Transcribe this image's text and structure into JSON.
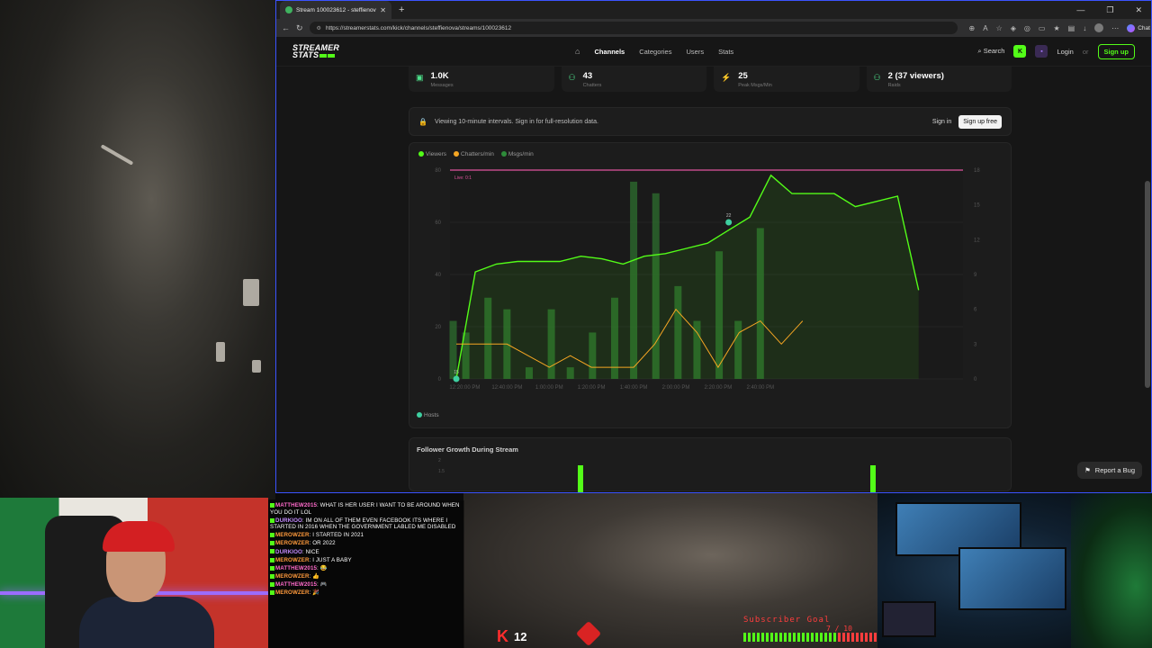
{
  "browser": {
    "tab_title": "Stream 100023612 - steffienova -",
    "url": "https://streamerstats.com/kick/channels/steffienova/streams/100023612",
    "chat_label": "Chat"
  },
  "site": {
    "logo_top": "STREAMER",
    "logo_bottom": "STATS",
    "nav": [
      "Channels",
      "Categories",
      "Users",
      "Stats"
    ],
    "search": "Search",
    "login": "Login",
    "or": "or",
    "signup": "Sign up"
  },
  "stats": [
    {
      "icon": "message-icon",
      "value": "1.0K",
      "label": "Messages"
    },
    {
      "icon": "users-icon",
      "value": "43",
      "label": "Chatters"
    },
    {
      "icon": "bolt-icon",
      "value": "25",
      "label": "Peak Msgs/Min"
    },
    {
      "icon": "users-icon",
      "value": "2 (37 viewers)",
      "label": "Raids"
    }
  ],
  "notice": {
    "text": "Viewing 10-minute intervals. Sign in for full-resolution data.",
    "signin": "Sign in",
    "signup": "Sign up free"
  },
  "chart_data": {
    "type": "line",
    "legend": [
      {
        "name": "Viewers",
        "color": "#53fc18"
      },
      {
        "name": "Chatters/min",
        "color": "#f5a623"
      },
      {
        "name": "Msgs/min",
        "color": "#2e8b3a"
      }
    ],
    "x_ticks": [
      "12:20:00 PM",
      "12:40:00 PM",
      "1:00:00 PM",
      "1:20:00 PM",
      "1:40:00 PM",
      "2:00:00 PM",
      "2:20:00 PM",
      "2:40:00 PM"
    ],
    "y_left_ticks": [
      "0",
      "20",
      "40",
      "60",
      "80"
    ],
    "y_right_ticks": [
      "0",
      "3",
      "6",
      "9",
      "12",
      "15",
      "18"
    ],
    "live_label": "Live: 0:1",
    "viewers_x": [
      12.2,
      12.5,
      12.833,
      13.167,
      13.5,
      13.833,
      14.167,
      14.5,
      14.833,
      15.167,
      15.5,
      15.833,
      16.167,
      16.5,
      16.833,
      17.167,
      17.5,
      17.833,
      18.167,
      18.5,
      18.833,
      19.167,
      19.5,
      19.833,
      20.167
    ],
    "viewers": [
      0,
      41,
      44,
      45,
      45,
      45,
      47,
      46,
      44,
      47,
      48,
      50,
      52,
      57,
      62,
      78,
      71,
      71,
      71,
      66,
      68,
      70,
      34,
      0,
      0
    ],
    "chatters_x": [
      12.2,
      12.333,
      12.667,
      13.0,
      13.333,
      13.667,
      14.0,
      14.333,
      14.667,
      15.0,
      15.333,
      15.667,
      16.0,
      16.333,
      16.667,
      17.0,
      17.333,
      17.667,
      18.0,
      18.333
    ],
    "chatters": [
      3,
      3,
      3,
      3,
      2,
      1,
      2,
      1,
      1,
      1,
      3,
      6,
      4,
      1,
      4,
      5,
      3,
      5,
      0,
      0
    ],
    "bars_x": [
      12.15,
      12.35,
      12.7,
      13.0,
      13.35,
      13.7,
      14.0,
      14.35,
      14.7,
      15.0,
      15.35,
      15.7,
      16.0,
      16.35,
      16.65,
      17.0,
      17.35,
      17.65,
      18.0,
      18.35
    ],
    "msgs": [
      5,
      4,
      7,
      6,
      1,
      6,
      1,
      4,
      7,
      17,
      16,
      8,
      5,
      11,
      5,
      13,
      0,
      0,
      0,
      0
    ],
    "markers": [
      {
        "label": "15",
        "x": 12.2,
        "y": 0
      },
      {
        "label": "22",
        "x": 16.5,
        "y": 60
      }
    ],
    "xlim": [
      12.1,
      20.2
    ],
    "ylim": [
      0,
      80
    ],
    "y2lim": [
      0,
      18
    ]
  },
  "hosts_label": "Hosts",
  "follower": {
    "title": "Follower Growth During Stream",
    "y_ticks": [
      "2",
      "1.5"
    ]
  },
  "report_bug": "Report a Bug",
  "overlay": {
    "chat": [
      {
        "user": "MATTHEW2015",
        "msg": "WHAT IS HER USER I WANT TO BE AROUND WHEN YOU DO IT LOL",
        "color": "#ff6bcb"
      },
      {
        "user": "DURKIOO",
        "msg": "IM ON ALL OF THEM EVEN FACEBOOK ITS WHERE I STARTED IN 2016 WHEN THE GOVERNMENT LABLED ME DISABLED",
        "color": "#c58cff"
      },
      {
        "user": "MEROWZER",
        "msg": "I STARTED IN 2021",
        "color": "#ff9a3c"
      },
      {
        "user": "MEROWZER",
        "msg": "OR 2022",
        "color": "#ff9a3c"
      },
      {
        "user": "DURKIOO",
        "msg": "NICE",
        "color": "#c58cff"
      },
      {
        "user": "MEROWZER",
        "msg": "I JUST A BABY",
        "color": "#ff9a3c"
      },
      {
        "user": "MATTHEW2015",
        "msg": "😂",
        "color": "#ff6bcb"
      },
      {
        "user": "MEROWZER",
        "msg": "👍",
        "color": "#ff9a3c"
      },
      {
        "user": "MATTHEW2015",
        "msg": "🎮",
        "color": "#ff6bcb"
      },
      {
        "user": "MEROWZER",
        "msg": "🎉",
        "color": "#ff9a3c"
      }
    ],
    "kick_count": "12",
    "subgoal_label": "Subscriber Goal",
    "subgoal_value": "7 / 10"
  }
}
